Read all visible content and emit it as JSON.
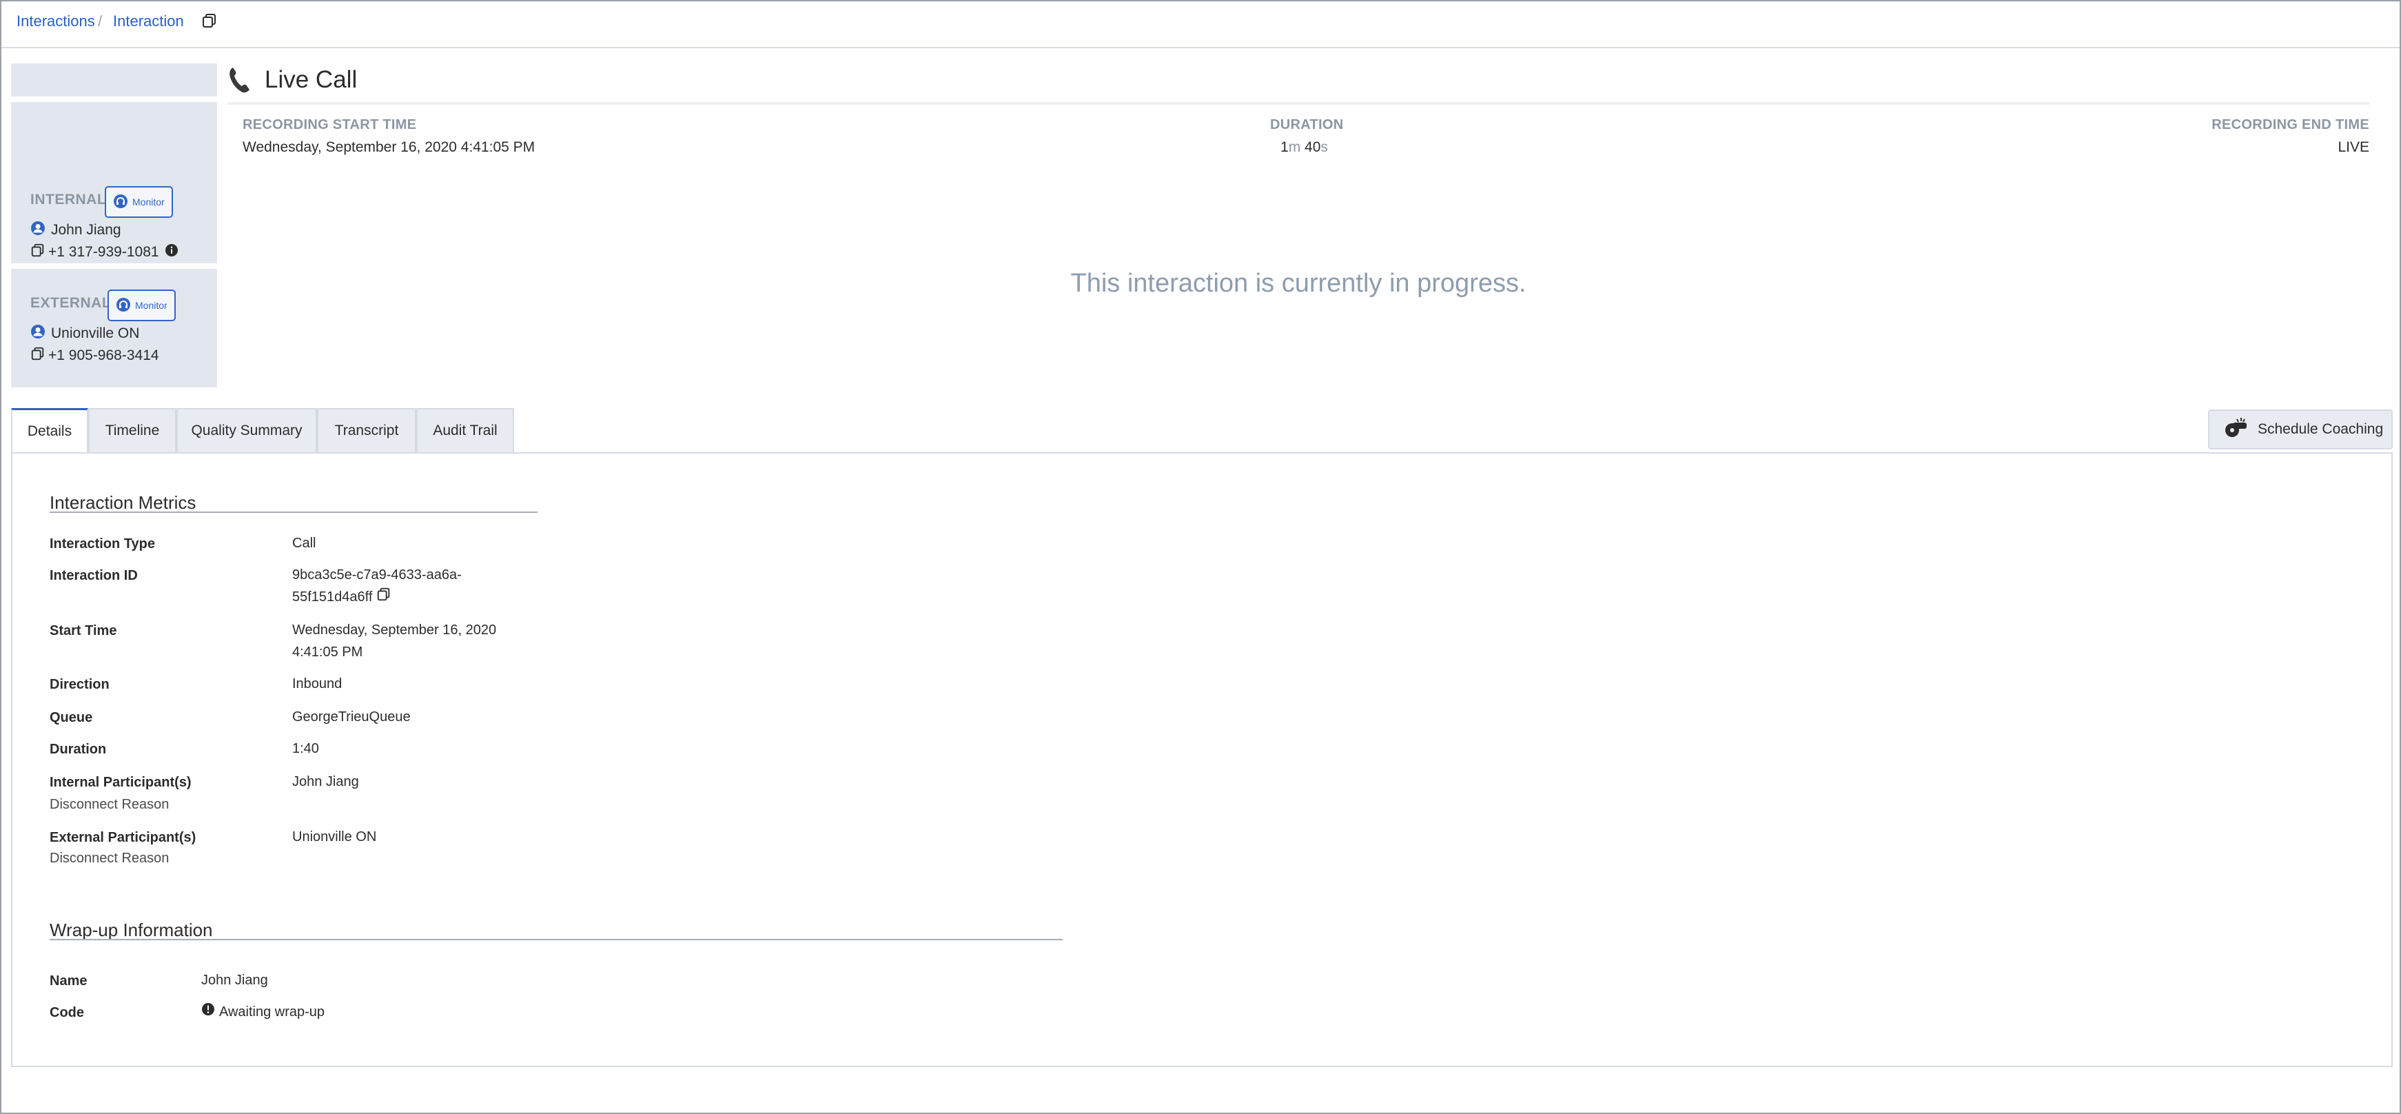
{
  "breadcrumb": {
    "items": [
      "Interactions",
      "Interaction"
    ],
    "separator": "/",
    "copy_icon": "copy-icon"
  },
  "header": {
    "icon": "phone-icon",
    "title": "Live Call",
    "recording_start": {
      "label": "RECORDING START TIME",
      "value": "Wednesday, September 16, 2020 4:41:05 PM"
    },
    "duration": {
      "label": "DURATION",
      "minutes": "1",
      "minutes_unit": "m",
      "seconds": "40",
      "seconds_unit": "s"
    },
    "recording_end": {
      "label": "RECORDING END TIME",
      "value": "LIVE"
    },
    "progress_message": "This interaction is currently in progress."
  },
  "participants": {
    "internal": {
      "label": "INTERNAL",
      "monitor_label": "Monitor",
      "name": "John Jiang",
      "phone": "+1 317-939-1081"
    },
    "external": {
      "label": "EXTERNAL",
      "monitor_label": "Monitor",
      "name": "Unionville ON",
      "phone": "+1 905-968-3414"
    }
  },
  "tabs": [
    {
      "label": "Details",
      "active": true
    },
    {
      "label": "Timeline",
      "active": false
    },
    {
      "label": "Quality Summary",
      "active": false
    },
    {
      "label": "Transcript",
      "active": false
    },
    {
      "label": "Audit Trail",
      "active": false
    }
  ],
  "schedule_coaching": {
    "label": "Schedule Coaching",
    "icon": "whistle-icon"
  },
  "metrics": {
    "title": "Interaction Metrics",
    "interaction_type": {
      "label": "Interaction Type",
      "value": "Call"
    },
    "interaction_id": {
      "label": "Interaction ID",
      "value_line1": "9bca3c5e-c7a9-4633-aa6a-",
      "value_line2": "55f151d4a6ff"
    },
    "start_time": {
      "label": "Start Time",
      "value_line1": "Wednesday, September 16, 2020",
      "value_line2": "4:41:05 PM"
    },
    "direction": {
      "label": "Direction",
      "value": "Inbound"
    },
    "queue": {
      "label": "Queue",
      "value": "GeorgeTrieuQueue"
    },
    "duration": {
      "label": "Duration",
      "value": "1:40"
    },
    "internal_participants": {
      "label": "Internal Participant(s)",
      "sub_label": "Disconnect Reason",
      "value": "John Jiang"
    },
    "external_participants": {
      "label": "External Participant(s)",
      "sub_label": "Disconnect Reason",
      "value": "Unionville ON"
    }
  },
  "wrapup": {
    "title": "Wrap-up Information",
    "name": {
      "label": "Name",
      "value": "John Jiang"
    },
    "code": {
      "label": "Code",
      "value": "Awaiting wrap-up"
    }
  },
  "colors": {
    "accent": "#2a60c8",
    "side_bg": "#e2e7ef",
    "muted_label": "#8c96a3",
    "progress_text": "#8e9caf"
  }
}
